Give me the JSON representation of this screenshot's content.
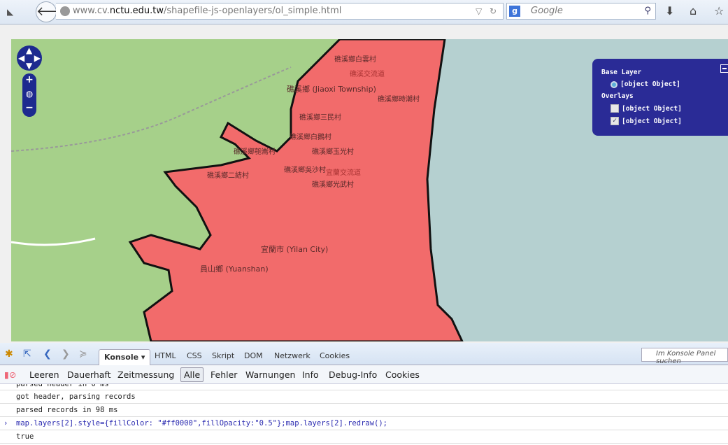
{
  "browser": {
    "url_prefix": "www.cv.",
    "url_domain": "nctu.edu.tw",
    "url_path": "/shapefile-js-openlayers/ol_simple.html",
    "search_engine": "Google",
    "search_placeholder": "Google"
  },
  "map": {
    "labels": [
      "礁溪鄉白雲村",
      "礁溪交流道",
      "礁溪鄉 (Jiaoxi Township)",
      "礁溪鄉時潮村",
      "礁溪鄉三民村",
      "礁溪鄉白鵝村",
      "礁溪鄉玉光村",
      "礁溪鄉匏崙村",
      "礁溪鄉二結村",
      "礁溪鄉吳沙村",
      "宜蘭交流道",
      "礁溪鄉光武村",
      "宜蘭市 (Yilan City)",
      "員山鄉 (Yuanshan)"
    ],
    "colors": {
      "land": "#a6d08a",
      "overlay": "#f26b6b",
      "sea": "#b5d0d0",
      "control": "#1d2a8f"
    }
  },
  "layer_switcher": {
    "base_title": "Base Layer",
    "base_item": "[object Object]",
    "overlays_title": "Overlays",
    "overlays": [
      {
        "label": "[object Object]",
        "checked": false
      },
      {
        "label": "[object Object]",
        "checked": true
      }
    ]
  },
  "devtools": {
    "tabs": [
      "Konsole ▾",
      "HTML",
      "CSS",
      "Skript",
      "DOM",
      "Netzwerk",
      "Cookies"
    ],
    "search_placeholder": "Im Konsole Panel suchen",
    "toolbar": [
      "Leeren",
      "Dauerhaft",
      "Zeitmessung"
    ],
    "filters": [
      "Alle",
      "Fehler",
      "Warnungen",
      "Info",
      "Debug-Info",
      "Cookies"
    ],
    "log": [
      "parsed header in 0 ms",
      "got header, parsing records",
      "parsed records in 98 ms",
      "map.layers[2].style={fillColor: \"#ff0000\",fillOpacity:\"0.5\"};map.layers[2].redraw();",
      "true"
    ]
  }
}
